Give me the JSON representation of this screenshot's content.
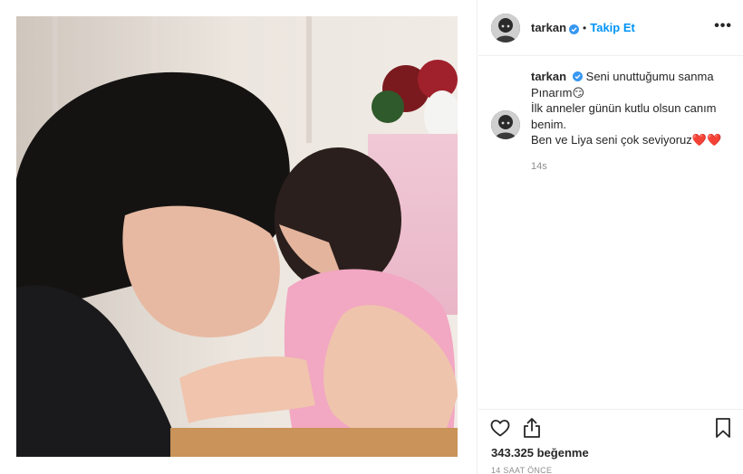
{
  "post": {
    "username": "tarkan",
    "follow_label": "Takip Et",
    "dot": "•",
    "more_label": "•••"
  },
  "caption": {
    "username": "tarkan",
    "lines": [
      "Seni unuttuğumu sanma",
      "Pınarım😏",
      "İlk anneler günün kutlu olsun canım",
      "benim.",
      "Ben ve Liya seni çok seviyoruz❤️❤️"
    ],
    "time": "14s"
  },
  "footer": {
    "likes": "343.325 beğenme",
    "ago": "14 SAAT ÖNCE"
  },
  "icons": {
    "verified": "verified-badge-icon",
    "like": "heart-outline-icon",
    "share": "share-icon",
    "save": "bookmark-icon"
  },
  "colors": {
    "follow": "#0095f6",
    "verified": "#3897f0",
    "muted": "#8e8e8e"
  }
}
